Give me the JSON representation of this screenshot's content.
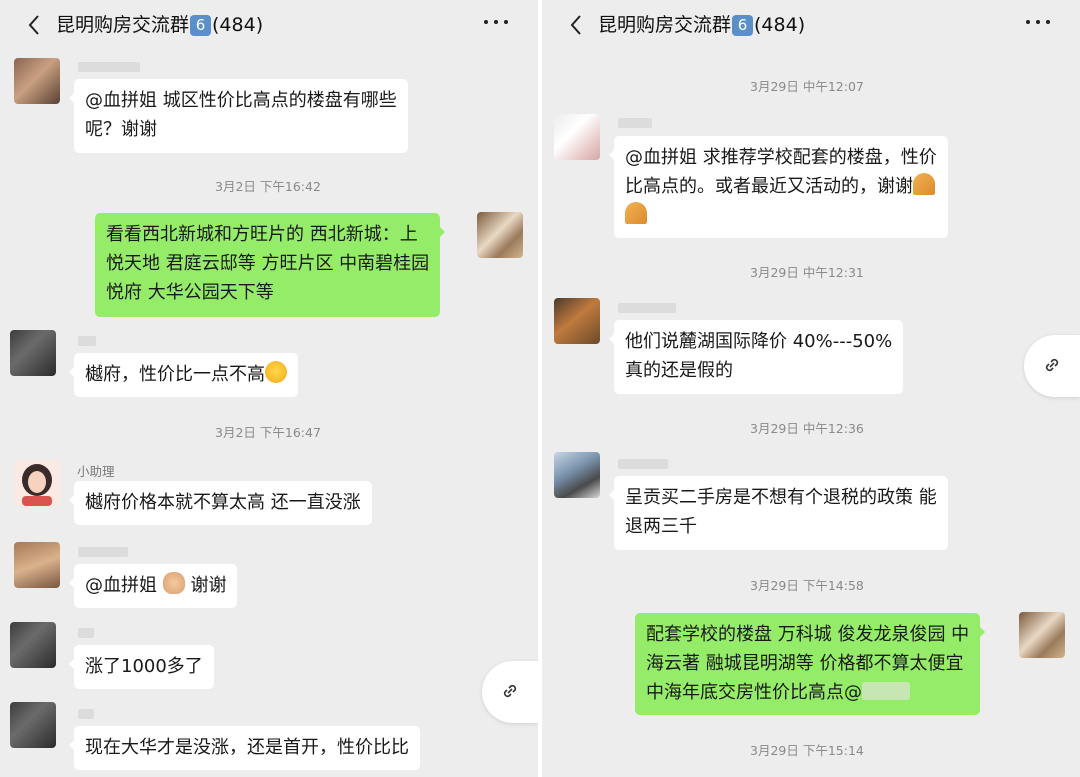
{
  "chat_title": "昆明购房交流群",
  "group_badge": "6",
  "member_count": "(484)",
  "left": {
    "msg1": {
      "line1": "@血拼姐  城区性价比高点的楼盘有哪些",
      "line2": "呢？谢谢"
    },
    "time1": "3月2日 下午16:42",
    "msg2": {
      "line1": "看看西北新城和方旺片的 西北新城：上",
      "line2": "悦天地 君庭云邸等 方旺片区 中南碧桂园",
      "line3": "悦府 大华公园天下等"
    },
    "msg3": {
      "text": "樾府，性价比一点不高"
    },
    "time2": "3月2日 下午16:47",
    "assistant_name": "小助理",
    "msg4": {
      "text": "樾府价格本就不算太高 还一直没涨"
    },
    "msg5": {
      "prefix": "@血拼姐",
      "suffix": "谢谢"
    },
    "msg6": {
      "text": "涨了1000多了"
    },
    "msg7": {
      "text": "现在大华才是没涨，还是首开，性价比比"
    }
  },
  "right": {
    "time1": "3月29日 中午12:07",
    "msg1": {
      "line1": "@血拼姐  求推荐学校配套的楼盘，性价",
      "line2": "比高点的。或者最近又活动的，谢谢"
    },
    "time2": "3月29日 中午12:31",
    "msg2": {
      "line1": "他们说麓湖国际降价 40%---50%",
      "line2": "真的还是假的"
    },
    "time3": "3月29日 中午12:36",
    "msg3": {
      "line1": "呈贡买二手房是不想有个退税的政策 能",
      "line2": "退两三千"
    },
    "time4": "3月29日 下午14:58",
    "msg4": {
      "line1": "配套学校的楼盘 万科城 俊发龙泉俊园 中",
      "line2": "海云著 融城昆明湖等 价格都不算太便宜",
      "line3": "中海年底交房性价比高点@"
    },
    "time5": "3月29日 下午15:14"
  },
  "icons": {
    "back": "chevron-left-icon",
    "more": "more-dots-icon",
    "float": "link-icon",
    "emoji_cry": "laugh-cry-emoji",
    "emoji_ok": "ok-hand-emoji",
    "emoji_pray": "praying-hands-emoji"
  },
  "colors": {
    "background": "#ededed",
    "bubble_other": "#ffffff",
    "bubble_me": "#95ec69",
    "timestamp": "#8a8a8a",
    "badge": "#5b8fc9"
  }
}
